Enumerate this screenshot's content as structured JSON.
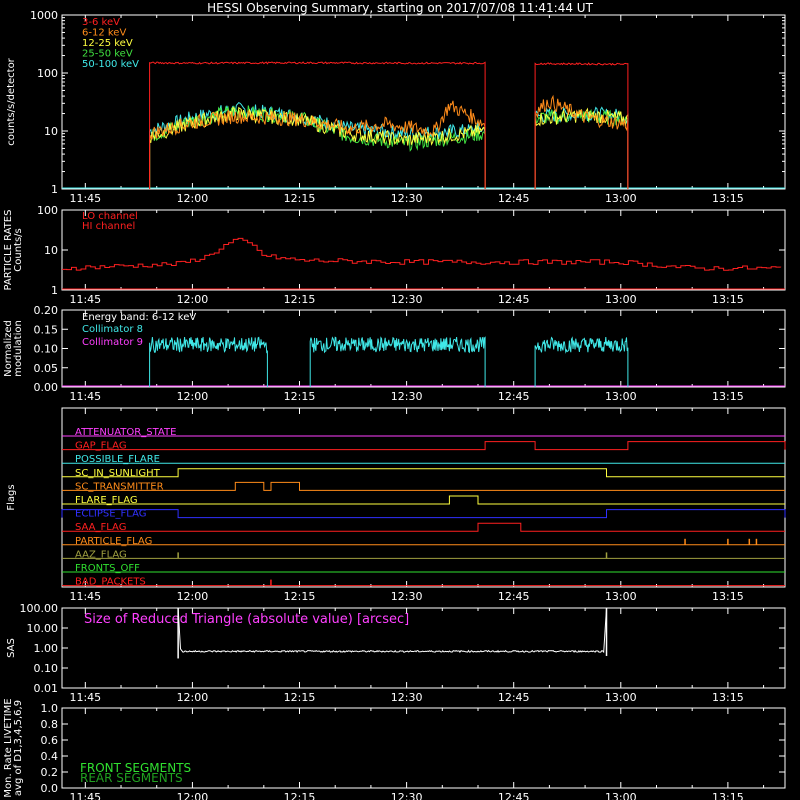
{
  "title": "HESSI Observing Summary, starting on 2017/07/08 11:41:44 UT",
  "x_ticks": [
    "11:45",
    "12:00",
    "12:15",
    "12:30",
    "12:45",
    "13:00",
    "13:15"
  ],
  "chart_data": [
    {
      "type": "line",
      "name": "count-rates",
      "ylabel": "counts/s/detector",
      "yscale": "log",
      "ylim": [
        1,
        1000
      ],
      "y_ticks": [
        "1",
        "10",
        "100",
        "1000"
      ],
      "xlim": [
        "11:41:44",
        "13:23:00"
      ],
      "legend_position": "top-left",
      "gaps": [
        [
          "11:48:45",
          "11:54:00"
        ],
        [
          "12:41:00",
          "12:48:00"
        ],
        [
          "13:01:30",
          "13:23:00"
        ]
      ],
      "series": [
        {
          "name": "3-6 keV",
          "color": "#ff2020",
          "x": [
            "11:54",
            "12:00",
            "12:15",
            "12:30",
            "12:41",
            "12:48",
            "13:01"
          ],
          "y": [
            150,
            148,
            150,
            148,
            148,
            145,
            142
          ]
        },
        {
          "name": "6-12 keV",
          "color": "#ff8c1a",
          "x": [
            "11:54",
            "12:00",
            "12:06",
            "12:15",
            "12:22",
            "12:27",
            "12:34",
            "12:36",
            "12:39",
            "12:41",
            "12:48",
            "12:50",
            "12:55",
            "13:01"
          ],
          "y": [
            9,
            14,
            18,
            16,
            11,
            13,
            10,
            28,
            18,
            13,
            22,
            32,
            17,
            13
          ]
        },
        {
          "name": "12-25 keV",
          "color": "#ffff40",
          "x": [
            "11:54",
            "12:00",
            "12:06",
            "12:15",
            "12:22",
            "12:30",
            "12:38",
            "12:41",
            "12:48",
            "12:55",
            "13:01"
          ],
          "y": [
            8,
            14,
            20,
            16,
            9,
            7,
            9,
            10,
            16,
            19,
            16
          ]
        },
        {
          "name": "25-50 keV",
          "color": "#40e040",
          "x": [
            "11:54",
            "12:00",
            "12:06",
            "12:15",
            "12:22",
            "12:30",
            "12:38",
            "12:41",
            "12:48",
            "12:55",
            "13:01"
          ],
          "y": [
            8,
            15,
            22,
            17,
            8,
            6,
            8,
            9,
            17,
            18,
            16
          ]
        },
        {
          "name": "50-100 keV",
          "color": "#40e8e8",
          "x": [
            "11:54",
            "12:00",
            "12:06",
            "12:15",
            "12:22",
            "12:30",
            "12:38",
            "12:41",
            "12:48",
            "12:55",
            "13:01"
          ],
          "y": [
            10,
            17,
            24,
            18,
            11,
            9,
            10,
            11,
            18,
            20,
            18
          ]
        }
      ]
    },
    {
      "type": "line",
      "name": "particle-rates",
      "ylabel": [
        "PARTICLE RATES",
        "Counts/s"
      ],
      "yscale": "log",
      "ylim": [
        1,
        100
      ],
      "y_ticks": [
        "1",
        "10",
        "100"
      ],
      "legend_position": "top-left",
      "series": [
        {
          "name": "LO channel",
          "color": "#ff2020",
          "x": [
            "11:41:44",
            "13:23:00"
          ],
          "y": [
            1,
            1
          ]
        },
        {
          "name": "HI channel",
          "color": "#ff2020",
          "x": [
            "11:41:44",
            "11:50",
            "11:58",
            "12:02",
            "12:04",
            "12:06",
            "12:08",
            "12:10",
            "12:15",
            "12:30",
            "12:45",
            "13:00",
            "13:10",
            "13:23:00"
          ],
          "y": [
            3.5,
            4,
            4.5,
            7,
            12,
            18,
            14,
            7,
            5.5,
            5,
            5,
            5,
            3.5,
            3.5
          ]
        }
      ]
    },
    {
      "type": "line",
      "name": "modulation",
      "ylabel": [
        "Normalized",
        "modulation"
      ],
      "ylim": [
        0,
        0.2
      ],
      "y_ticks": [
        "0.00",
        "0.05",
        "0.10",
        "0.15",
        "0.20"
      ],
      "annotation": "Energy band: 6-12 keV",
      "legend_position": "top-left",
      "segments": [
        [
          "11:54",
          "12:10:30"
        ],
        [
          "12:16:30",
          "12:41"
        ],
        [
          "12:48",
          "13:01"
        ]
      ],
      "series": [
        {
          "name": "Collimator 8",
          "color": "#40e8e8",
          "mean": 0.11,
          "spread": 0.02
        },
        {
          "name": "Collimator 9",
          "color": "#ff40ff",
          "mean": 0.0,
          "spread": 0.0
        }
      ]
    },
    {
      "type": "line",
      "name": "flags",
      "ylabel": "Flags",
      "flags": [
        {
          "name": "ATTENUATOR_STATE",
          "color": "#ff40ff",
          "segments": []
        },
        {
          "name": "GAP_FLAG",
          "color": "#ff2020",
          "segments": [
            [
              "12:41",
              "12:48"
            ],
            [
              "13:01",
              "13:23"
            ]
          ]
        },
        {
          "name": "POSSIBLE_FLARE",
          "color": "#40e8e8",
          "segments": []
        },
        {
          "name": "SC_IN_SUNLIGHT",
          "color": "#ffff40",
          "segments": [
            [
              "11:58",
              "12:58"
            ]
          ]
        },
        {
          "name": "SC_TRANSMITTER",
          "color": "#ff8c1a",
          "segments": [
            [
              "12:06",
              "12:10"
            ],
            [
              "12:11",
              "12:15"
            ]
          ]
        },
        {
          "name": "FLARE_FLAG",
          "color": "#ffff40",
          "segments": [
            [
              "12:36",
              "12:40"
            ]
          ]
        },
        {
          "name": "ECLIPSE_FLAG",
          "color": "#3030ff",
          "segments": [
            [
              "11:41:44",
              "11:58"
            ],
            [
              "12:58",
              "13:23"
            ]
          ]
        },
        {
          "name": "SAA_FLAG",
          "color": "#ff2020",
          "segments": [
            [
              "12:40",
              "12:46"
            ]
          ]
        },
        {
          "name": "PARTICLE_FLAG",
          "color": "#ff8c1a",
          "spikes": [
            "13:09",
            "13:15",
            "13:18",
            "13:19"
          ]
        },
        {
          "name": "AAZ_FLAG",
          "color": "#a0a040",
          "spikes": [
            "11:58",
            "12:58"
          ]
        },
        {
          "name": "FRONTS_OFF",
          "color": "#30e030",
          "segments": []
        },
        {
          "name": "BAD_PACKETS",
          "color": "#ff2020",
          "spikes": [
            "12:11"
          ]
        }
      ]
    },
    {
      "type": "line",
      "name": "sas",
      "ylabel": "SAS",
      "yscale": "log",
      "ylim": [
        0.01,
        100
      ],
      "y_ticks": [
        "0.01",
        "0.10",
        "1.00",
        "10.00",
        "100.00"
      ],
      "annotation": "Size of Reduced Triangle (absolute value) [arcsec]",
      "series": [
        {
          "name": "triangle",
          "color": "#ffffff",
          "x": [
            "11:58",
            "11:58:30",
            "12:30",
            "12:58"
          ],
          "y": [
            100,
            0.7,
            0.7,
            0.8
          ]
        }
      ]
    },
    {
      "type": "line",
      "name": "livetime",
      "ylabel": [
        "Mon. Rate LIVETIME",
        "avg of D1,3,4,5,6,9"
      ],
      "ylim": [
        0,
        1
      ],
      "y_ticks": [
        "0.0",
        "0.2",
        "0.4",
        "0.6",
        "0.8",
        "1.0"
      ],
      "legend_position": "bottom-left",
      "series": [
        {
          "name": "FRONT SEGMENTS",
          "color": "#30e030"
        },
        {
          "name": "REAR SEGMENTS",
          "color": "#20a020"
        }
      ]
    }
  ]
}
